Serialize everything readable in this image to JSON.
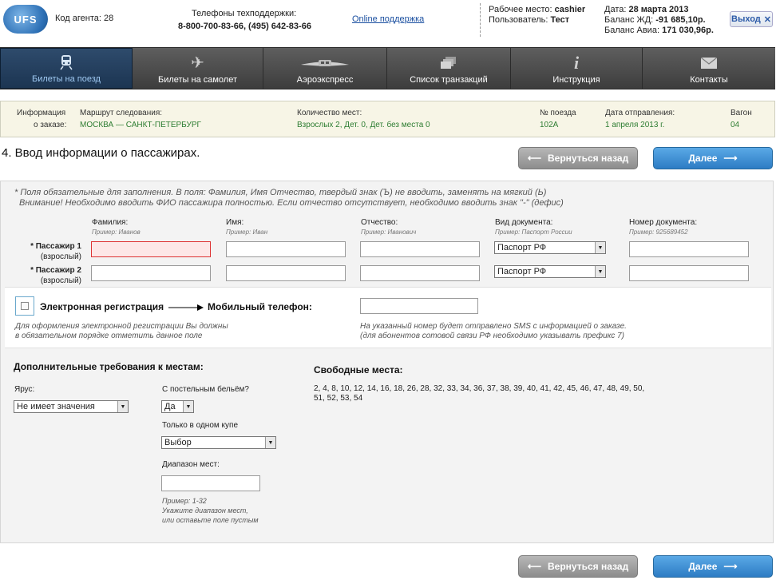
{
  "header": {
    "logo_text": "UFS",
    "agent_code": "Код агента: 28",
    "support_label": "Телефоны техподдержки:",
    "support_phones": "8-800-700-83-66, (495) 642-83-66",
    "online_support": "Online поддержка",
    "workplace_label": "Рабочее место:",
    "workplace_value": "cashier",
    "user_label": "Пользователь:",
    "user_value": "Тест",
    "date_label": "Дата:",
    "date_value": "28 марта 2013",
    "balance_rail_label": "Баланс ЖД:",
    "balance_rail_value": "-91 685,10р.",
    "balance_air_label": "Баланс Авиа:",
    "balance_air_value": "171 030,96р.",
    "logout_label": "Выход",
    "logout_icon": "close-icon"
  },
  "nav": {
    "items": [
      {
        "label": "Билеты на поезд",
        "icon": "train-icon",
        "active": true
      },
      {
        "label": "Билеты на самолет",
        "icon": "plane-icon",
        "active": false
      },
      {
        "label": "Аэроэкспресс",
        "icon": "aeroexpress-icon",
        "active": false
      },
      {
        "label": "Список транзакций",
        "icon": "transactions-icon",
        "active": false
      },
      {
        "label": "Инструкция",
        "icon": "info-icon",
        "active": false
      },
      {
        "label": "Контакты",
        "icon": "mail-icon",
        "active": false
      }
    ]
  },
  "order": {
    "info_label_1": "Информация",
    "info_label_2": "о заказе:",
    "route_label": "Маршрут следования:",
    "route_value": "МОСКВА — САНКТ-ПЕТЕРБУРГ",
    "seats_label": "Количество мест:",
    "seats_value": "Взрослых 2, Дет. 0, Дет. без места 0",
    "train_label": "№ поезда",
    "train_value": "102А",
    "departure_label": "Дата отправления:",
    "departure_value": "1 апреля 2013 г.",
    "car_label": "Вагон",
    "car_value": "04"
  },
  "step_title": "4. Ввод информации о пассажирах.",
  "buttons": {
    "back": "Вернуться назад",
    "next": "Далее"
  },
  "notes": {
    "line1": "* Поля обязательные для заполнения. В поля: Фамилия, Имя Отчество, твердый знак (Ъ) не вводить, заменять на мягкий (Ь)",
    "line2": "Внимание! Необходимо вводить ФИО пассажира полностью. Если отчество отсутствует, необходимо вводить знак \"-\" (дефис)"
  },
  "columns": [
    {
      "label": "Фамилия:",
      "example": "Пример: Иванов"
    },
    {
      "label": "Имя:",
      "example": "Пример: Иван"
    },
    {
      "label": "Отчество:",
      "example": "Пример: Иванович"
    },
    {
      "label": "Вид документа:",
      "example": "Пример: Паспорт России"
    },
    {
      "label": "Номер документа:",
      "example": "Пример: 925689452"
    }
  ],
  "passengers": [
    {
      "label": "* Пассажир 1",
      "type": "(взрослый)",
      "surname": "",
      "name": "",
      "patronymic": "",
      "document": "Паспорт РФ",
      "number": ""
    },
    {
      "label": "* Пассажир 2",
      "type": "(взрослый)",
      "surname": "",
      "name": "",
      "patronymic": "",
      "document": "Паспорт РФ",
      "number": ""
    }
  ],
  "ereg": {
    "checkbox_label": "Электронная регистрация",
    "phone_label": "Мобильный телефон:",
    "phone_value": "",
    "note_left_1": "Для оформления электронной регистрации Вы должны",
    "note_left_2": "в обязательном порядке отметить данное поле",
    "note_right_1": "На указанный номер будет отправлено SMS с информацией о заказе.",
    "note_right_2": "(для абонентов сотовой связи РФ необходимо указывать префикс 7)"
  },
  "requirements": {
    "title": "Дополнительные требования к местам:",
    "tier_label": "Ярус:",
    "tier_value": "Не имеет значения",
    "linen_label": "С постельным бельём?",
    "linen_value": "Да",
    "one_coupe_label": "Только в одном купе",
    "one_coupe_value": "Выбор",
    "range_label": "Диапазон мест:",
    "range_value": "",
    "range_hint_1": "Пример: 1-32",
    "range_hint_2": "Укажите диапазон мест,",
    "range_hint_3": "или оставьте поле пустым"
  },
  "free_seats": {
    "title": "Свободные места:",
    "line1": "2, 4, 8, 10, 12, 14, 16, 18, 26, 28, 32, 33, 34, 36, 37, 38, 39, 40, 41, 42, 45, 46, 47, 48, 49, 50,",
    "line2": "51, 52, 53, 54"
  }
}
